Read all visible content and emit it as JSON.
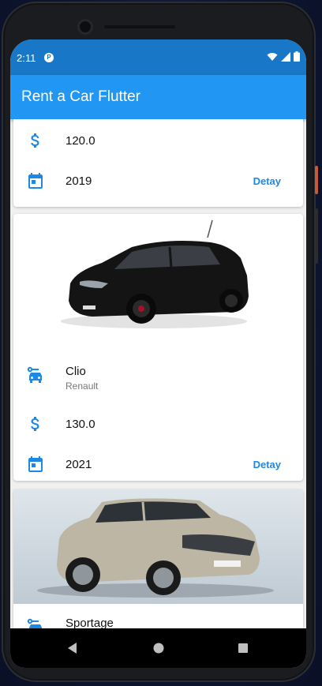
{
  "status_bar": {
    "time": "2:11",
    "app_badge": "P"
  },
  "app_bar": {
    "title": "Rent a Car Flutter"
  },
  "cars": [
    {
      "price": "120.0",
      "year": "2019",
      "action": "Detay"
    },
    {
      "image": "black-renault-clio-photo",
      "model": "Clio",
      "brand": "Renault",
      "price": "130.0",
      "year": "2021",
      "action": "Detay"
    },
    {
      "image": "silver-kia-sportage-photo",
      "model": "Sportage"
    }
  ],
  "colors": {
    "primary": "#2196f3",
    "status_bar": "#1878c7",
    "accent": "#1e88e5"
  },
  "icons": [
    "dollar-icon",
    "calendar-icon",
    "car-icon",
    "wifi-icon",
    "signal-icon",
    "battery-icon",
    "back-icon",
    "home-icon",
    "recents-icon"
  ]
}
